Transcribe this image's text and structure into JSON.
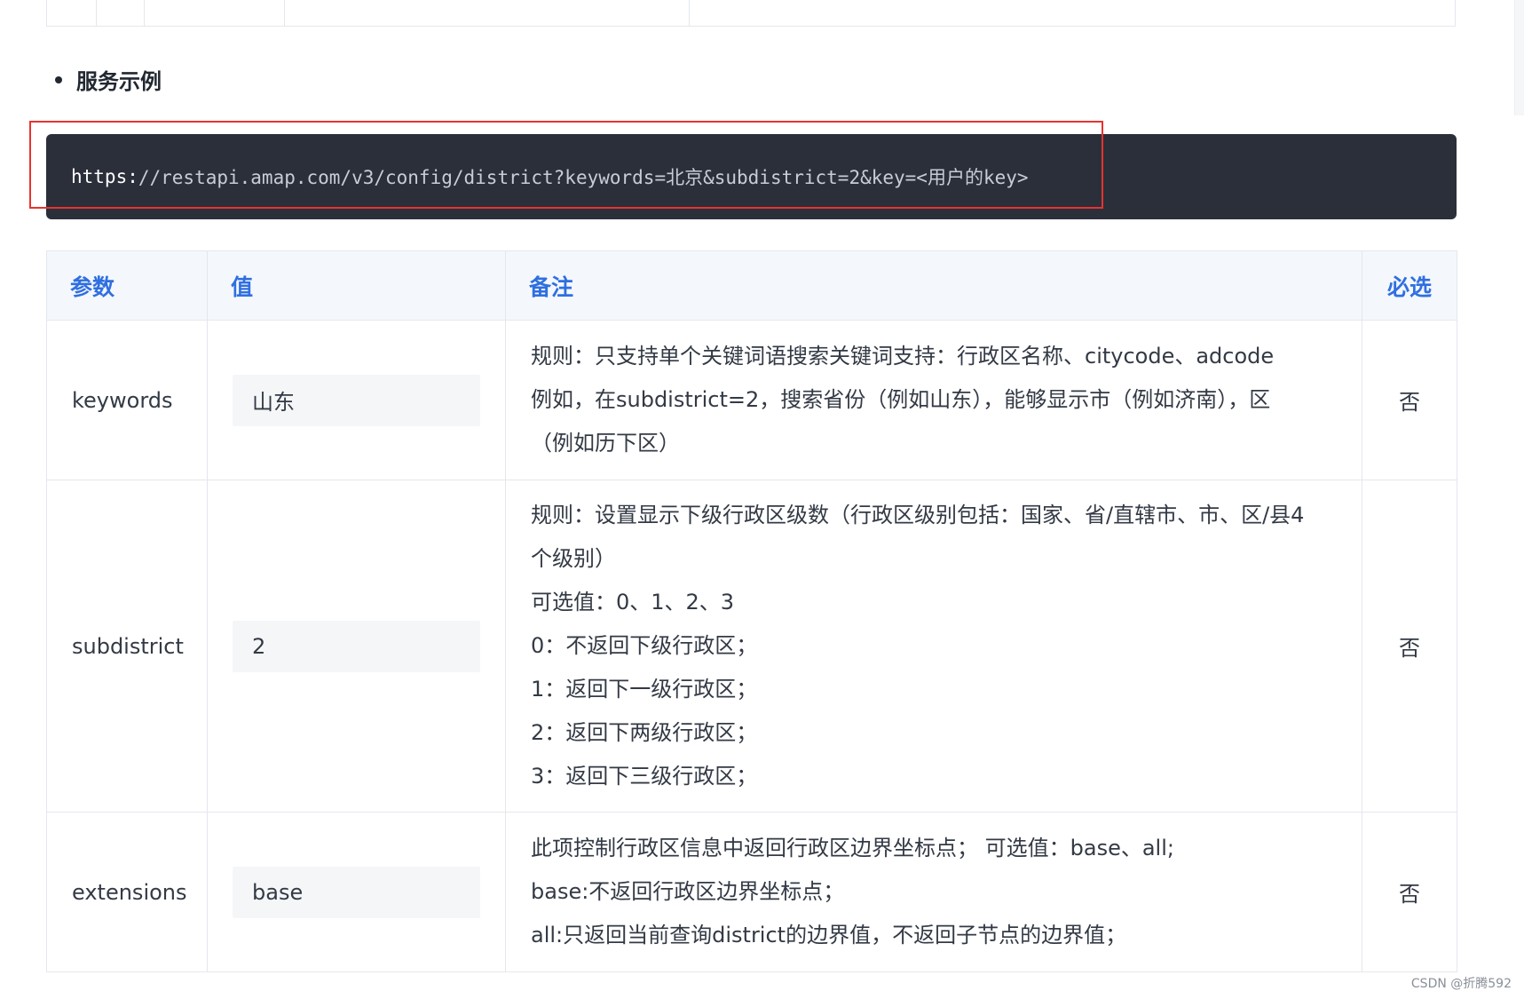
{
  "section": {
    "heading": "服务示例"
  },
  "code_example": {
    "scheme": "https:",
    "rest": "//restapi.amap.com/v3/config/district?keywords=北京&subdistrict=2&key=<用户的key>"
  },
  "table": {
    "headers": [
      "参数",
      "值",
      "备注",
      "必选"
    ],
    "rows": [
      {
        "param": "keywords",
        "value": "山东",
        "note": [
          "规则：只支持单个关键词语搜索关键词支持：行政区名称、citycode、adcode",
          "例如，在subdistrict=2，搜索省份（例如山东），能够显示市（例如济南），区",
          "（例如历下区）"
        ],
        "required": "否"
      },
      {
        "param": "subdistrict",
        "value": "2",
        "note": [
          "规则：设置显示下级行政区级数（行政区级别包括：国家、省/直辖市、市、区/县4",
          "个级别）",
          "可选值：0、1、2、3",
          "0：不返回下级行政区；",
          "1：返回下一级行政区；",
          "2：返回下两级行政区；",
          "3：返回下三级行政区；"
        ],
        "required": "否"
      },
      {
        "param": "extensions",
        "value": "base",
        "note": [
          "此项控制行政区信息中返回行政区边界坐标点； 可选值：base、all;",
          "base:不返回行政区边界坐标点；",
          "all:只返回当前查询district的边界值，不返回子节点的边界值；"
        ],
        "required": "否"
      }
    ]
  },
  "watermark": "CSDN @折腾592",
  "colors": {
    "header_text": "#2f6fe0",
    "code_bg": "#2b2f3a",
    "highlight_border": "#e8332e"
  }
}
